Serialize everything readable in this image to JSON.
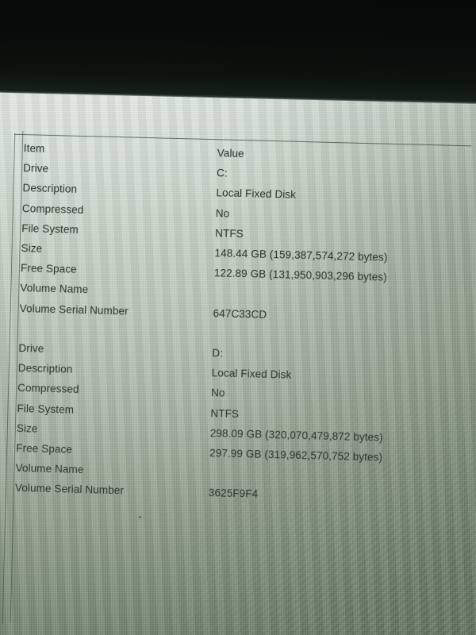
{
  "screen": {
    "background_color": "#cbd7cb",
    "text_color": "#24312a",
    "bezel_color": "#080b09"
  },
  "table": {
    "columns": [
      "Item",
      "Value"
    ],
    "header": {
      "item": "Item",
      "value": "Value"
    },
    "sections": [
      {
        "rows": [
          {
            "item": "Drive",
            "value": "C:"
          },
          {
            "item": "Description",
            "value": "Local Fixed Disk"
          },
          {
            "item": "Compressed",
            "value": "No"
          },
          {
            "item": "File System",
            "value": "NTFS"
          },
          {
            "item": "Size",
            "value": "148.44 GB (159,387,574,272 bytes)"
          },
          {
            "item": "Free Space",
            "value": "122.89 GB (131,950,903,296 bytes)"
          },
          {
            "item": "Volume Name",
            "value": ""
          },
          {
            "item": "Volume Serial Number",
            "value": "647C33CD"
          }
        ]
      },
      {
        "rows": [
          {
            "item": "Drive",
            "value": "D:"
          },
          {
            "item": "Description",
            "value": "Local Fixed Disk"
          },
          {
            "item": "Compressed",
            "value": "No"
          },
          {
            "item": "File System",
            "value": "NTFS"
          },
          {
            "item": "Size",
            "value": "298.09 GB (320,070,479,872 bytes)"
          },
          {
            "item": "Free Space",
            "value": "297.99 GB (319,962,570,752 bytes)"
          },
          {
            "item": "Volume Name",
            "value": ""
          },
          {
            "item": "Volume Serial Number",
            "value": "3625F9F4"
          }
        ]
      }
    ]
  }
}
